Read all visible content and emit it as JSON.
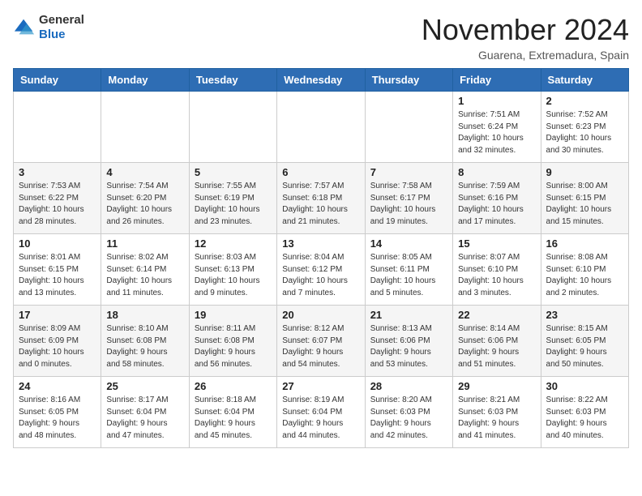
{
  "header": {
    "logo": {
      "general": "General",
      "blue": "Blue"
    },
    "title": "November 2024",
    "subtitle": "Guarena, Extremadura, Spain"
  },
  "weekdays": [
    "Sunday",
    "Monday",
    "Tuesday",
    "Wednesday",
    "Thursday",
    "Friday",
    "Saturday"
  ],
  "weeks": [
    [
      {
        "day": "",
        "info": ""
      },
      {
        "day": "",
        "info": ""
      },
      {
        "day": "",
        "info": ""
      },
      {
        "day": "",
        "info": ""
      },
      {
        "day": "",
        "info": ""
      },
      {
        "day": "1",
        "info": "Sunrise: 7:51 AM\nSunset: 6:24 PM\nDaylight: 10 hours\nand 32 minutes."
      },
      {
        "day": "2",
        "info": "Sunrise: 7:52 AM\nSunset: 6:23 PM\nDaylight: 10 hours\nand 30 minutes."
      }
    ],
    [
      {
        "day": "3",
        "info": "Sunrise: 7:53 AM\nSunset: 6:22 PM\nDaylight: 10 hours\nand 28 minutes."
      },
      {
        "day": "4",
        "info": "Sunrise: 7:54 AM\nSunset: 6:20 PM\nDaylight: 10 hours\nand 26 minutes."
      },
      {
        "day": "5",
        "info": "Sunrise: 7:55 AM\nSunset: 6:19 PM\nDaylight: 10 hours\nand 23 minutes."
      },
      {
        "day": "6",
        "info": "Sunrise: 7:57 AM\nSunset: 6:18 PM\nDaylight: 10 hours\nand 21 minutes."
      },
      {
        "day": "7",
        "info": "Sunrise: 7:58 AM\nSunset: 6:17 PM\nDaylight: 10 hours\nand 19 minutes."
      },
      {
        "day": "8",
        "info": "Sunrise: 7:59 AM\nSunset: 6:16 PM\nDaylight: 10 hours\nand 17 minutes."
      },
      {
        "day": "9",
        "info": "Sunrise: 8:00 AM\nSunset: 6:15 PM\nDaylight: 10 hours\nand 15 minutes."
      }
    ],
    [
      {
        "day": "10",
        "info": "Sunrise: 8:01 AM\nSunset: 6:15 PM\nDaylight: 10 hours\nand 13 minutes."
      },
      {
        "day": "11",
        "info": "Sunrise: 8:02 AM\nSunset: 6:14 PM\nDaylight: 10 hours\nand 11 minutes."
      },
      {
        "day": "12",
        "info": "Sunrise: 8:03 AM\nSunset: 6:13 PM\nDaylight: 10 hours\nand 9 minutes."
      },
      {
        "day": "13",
        "info": "Sunrise: 8:04 AM\nSunset: 6:12 PM\nDaylight: 10 hours\nand 7 minutes."
      },
      {
        "day": "14",
        "info": "Sunrise: 8:05 AM\nSunset: 6:11 PM\nDaylight: 10 hours\nand 5 minutes."
      },
      {
        "day": "15",
        "info": "Sunrise: 8:07 AM\nSunset: 6:10 PM\nDaylight: 10 hours\nand 3 minutes."
      },
      {
        "day": "16",
        "info": "Sunrise: 8:08 AM\nSunset: 6:10 PM\nDaylight: 10 hours\nand 2 minutes."
      }
    ],
    [
      {
        "day": "17",
        "info": "Sunrise: 8:09 AM\nSunset: 6:09 PM\nDaylight: 10 hours\nand 0 minutes."
      },
      {
        "day": "18",
        "info": "Sunrise: 8:10 AM\nSunset: 6:08 PM\nDaylight: 9 hours\nand 58 minutes."
      },
      {
        "day": "19",
        "info": "Sunrise: 8:11 AM\nSunset: 6:08 PM\nDaylight: 9 hours\nand 56 minutes."
      },
      {
        "day": "20",
        "info": "Sunrise: 8:12 AM\nSunset: 6:07 PM\nDaylight: 9 hours\nand 54 minutes."
      },
      {
        "day": "21",
        "info": "Sunrise: 8:13 AM\nSunset: 6:06 PM\nDaylight: 9 hours\nand 53 minutes."
      },
      {
        "day": "22",
        "info": "Sunrise: 8:14 AM\nSunset: 6:06 PM\nDaylight: 9 hours\nand 51 minutes."
      },
      {
        "day": "23",
        "info": "Sunrise: 8:15 AM\nSunset: 6:05 PM\nDaylight: 9 hours\nand 50 minutes."
      }
    ],
    [
      {
        "day": "24",
        "info": "Sunrise: 8:16 AM\nSunset: 6:05 PM\nDaylight: 9 hours\nand 48 minutes."
      },
      {
        "day": "25",
        "info": "Sunrise: 8:17 AM\nSunset: 6:04 PM\nDaylight: 9 hours\nand 47 minutes."
      },
      {
        "day": "26",
        "info": "Sunrise: 8:18 AM\nSunset: 6:04 PM\nDaylight: 9 hours\nand 45 minutes."
      },
      {
        "day": "27",
        "info": "Sunrise: 8:19 AM\nSunset: 6:04 PM\nDaylight: 9 hours\nand 44 minutes."
      },
      {
        "day": "28",
        "info": "Sunrise: 8:20 AM\nSunset: 6:03 PM\nDaylight: 9 hours\nand 42 minutes."
      },
      {
        "day": "29",
        "info": "Sunrise: 8:21 AM\nSunset: 6:03 PM\nDaylight: 9 hours\nand 41 minutes."
      },
      {
        "day": "30",
        "info": "Sunrise: 8:22 AM\nSunset: 6:03 PM\nDaylight: 9 hours\nand 40 minutes."
      }
    ]
  ]
}
